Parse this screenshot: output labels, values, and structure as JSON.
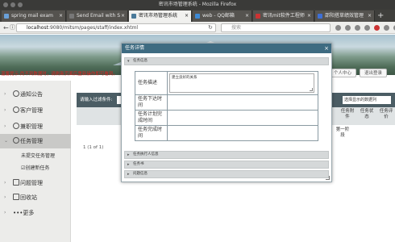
{
  "window": {
    "title": "密讯市场管理系统 - Mozilla Firefox"
  },
  "tabs": [
    {
      "label": "spring mail exam",
      "color": "#6aa0d8"
    },
    {
      "label": "Send Email with S",
      "color": "#444"
    },
    {
      "label": "密讯市场管理系统",
      "color": "#4a7a9a"
    },
    {
      "label": "web - QQ邮箱",
      "color": "#3d8ad6"
    },
    {
      "label": "密讯mit软件工程师 ",
      "color": "#cc3333"
    },
    {
      "label": "邵阳搭草绩效管理",
      "color": "#3d6fd6"
    }
  ],
  "nav": {
    "url_host": "localhost",
    "url_path": ":9080/mitsm/pages/staff/index.xhtml",
    "search_placeholder": "搜索"
  },
  "notice": "温馨提示:尚不到数据时，请刷新页面后重新操作即可看到。",
  "topbar": {
    "btn1": "个人中心",
    "btn2": "退出登录"
  },
  "sidebar": {
    "items": [
      {
        "label": "通知公告"
      },
      {
        "label": "客户管理"
      },
      {
        "label": "兼职管理"
      },
      {
        "label": "任务管理"
      },
      {
        "label": "问题管理"
      },
      {
        "label": "回收站"
      },
      {
        "label": "更多"
      }
    ],
    "subitems": [
      "未提交任务管理",
      "创建新任务"
    ]
  },
  "main": {
    "filter_label": "请输入过滤条件:",
    "filter_select": "选择显示的数据列",
    "col1": "任务附件",
    "col2": "任务状态",
    "col3": "任务评价",
    "row_col1": "第一阶段",
    "pager": "1 (1 of 1)"
  },
  "dialog": {
    "title": "任务详情",
    "section_info": "任务信息",
    "labels": {
      "desc": "任务描述",
      "issued": "任务下达时间",
      "planned": "任务计划完成时间",
      "done": "任务完成时间"
    },
    "desc_value": "建立良好的关系",
    "section_exec": "任务执行人信息",
    "section_task": "任务书",
    "section_issue": "问题信息"
  }
}
